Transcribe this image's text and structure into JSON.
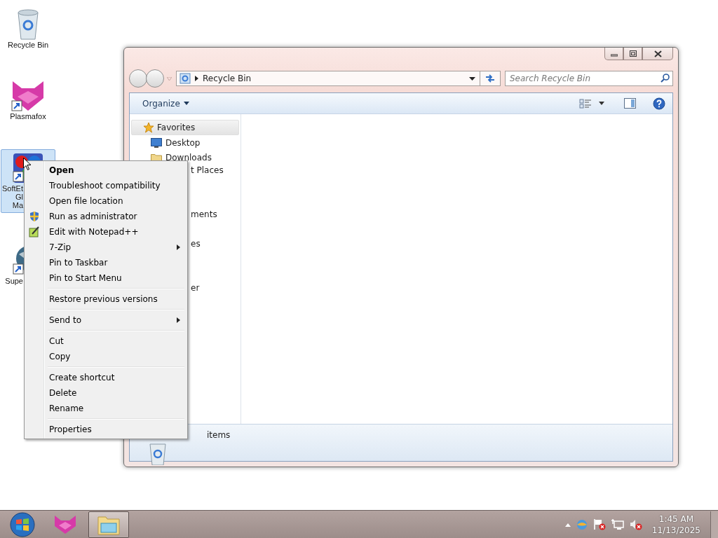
{
  "desktop_icons": [
    {
      "kind": "recycle",
      "label_lines": [
        "Recycle Bin"
      ],
      "selected": false
    },
    {
      "kind": "plasmafox",
      "label_lines": [
        "Plasmafox"
      ],
      "selected": false
    },
    {
      "kind": "softether",
      "label_lines": [
        "SoftEt",
        "Gl",
        "Ma"
      ],
      "selected": true
    },
    {
      "kind": "globe",
      "label_lines": [
        "Supe"
      ],
      "selected": false
    }
  ],
  "explorer": {
    "address": "Recycle Bin",
    "search": {
      "placeholder": "Search Recycle Bin"
    },
    "toolbar": {
      "organize": "Organize"
    },
    "nav_pane": {
      "favorites": "Favorites",
      "items": [
        "Desktop",
        "Downloads"
      ],
      "fragments": [
        "t Places",
        "ments",
        "es",
        "er"
      ]
    },
    "status": "items"
  },
  "context_menu": {
    "groups": [
      [
        {
          "label": "Open",
          "default": true
        },
        {
          "label": "Troubleshoot compatibility",
          "default": false
        },
        {
          "label": "Open file location",
          "default": false
        },
        {
          "label": "Run as administrator",
          "default": false
        },
        {
          "label": "Edit with Notepad++",
          "default": false
        },
        {
          "label": "7-Zip",
          "default": false,
          "submenu": true
        },
        {
          "label": "Pin to Taskbar",
          "default": false
        },
        {
          "label": "Pin to Start Menu",
          "default": false
        }
      ],
      [
        {
          "label": "Restore previous versions",
          "default": false
        }
      ],
      [
        {
          "label": "Send to",
          "default": false,
          "submenu": true
        }
      ],
      [
        {
          "label": "Cut",
          "default": false
        },
        {
          "label": "Copy",
          "default": false
        }
      ],
      [
        {
          "label": "Create shortcut",
          "default": false
        },
        {
          "label": "Delete",
          "default": false
        },
        {
          "label": "Rename",
          "default": false
        }
      ],
      [
        {
          "label": "Properties",
          "default": false
        }
      ]
    ]
  },
  "taskbar": {
    "buttons": [
      {
        "kind": "start",
        "selected": false
      },
      {
        "kind": "plasmafox",
        "selected": false
      },
      {
        "kind": "explorer",
        "selected": true
      }
    ],
    "clock": {
      "time": "1:45 AM",
      "date": "11/13/2025"
    }
  }
}
